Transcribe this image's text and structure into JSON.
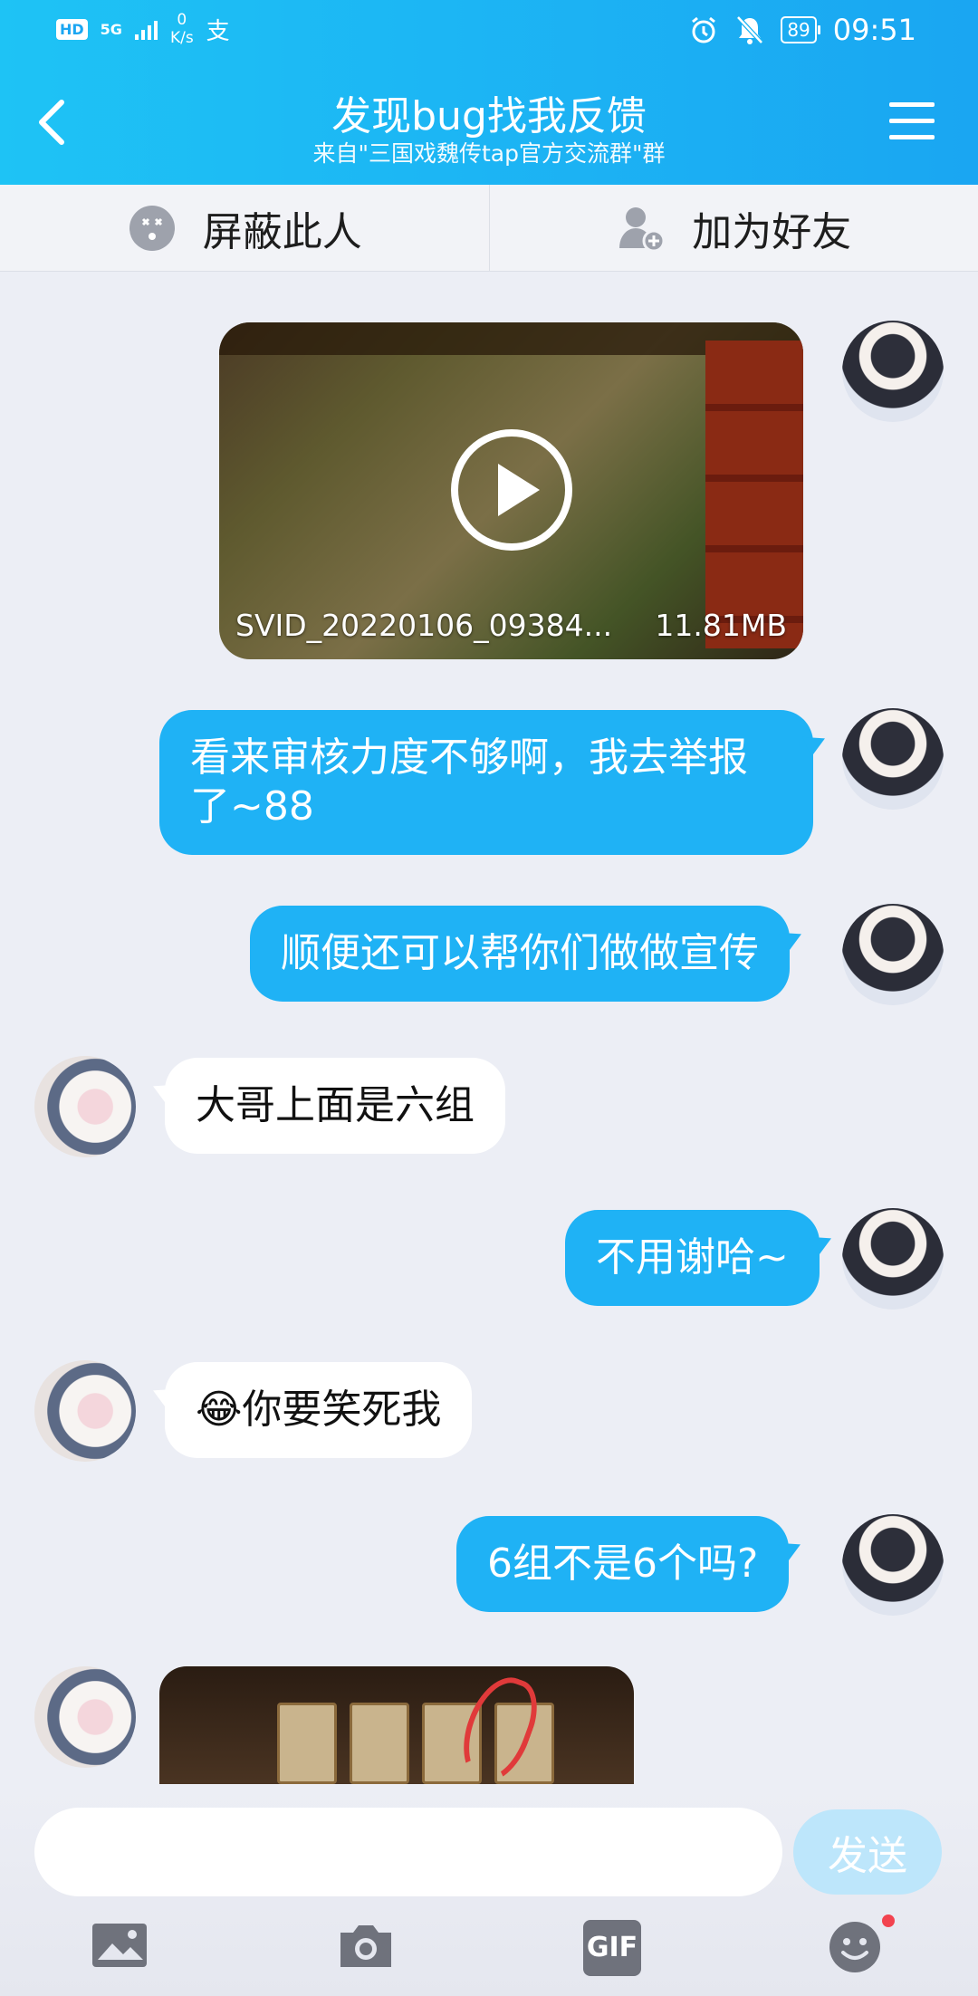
{
  "status_bar": {
    "network_badge": "HD",
    "network_type": "5G",
    "speed_value": "0",
    "speed_unit": "K/s",
    "battery": "89",
    "time": "09:51"
  },
  "header": {
    "title": "发现bug找我反馈",
    "subtitle": "来自\"三国戏魏传tap官方交流群\"群"
  },
  "actions": {
    "block_label": "屏蔽此人",
    "add_friend_label": "加为好友"
  },
  "messages": {
    "video": {
      "filename": "SVID_20220106_09384...",
      "size": "11.81MB"
    },
    "m1": "看来审核力度不够啊，我去举报了~88",
    "m2": "顺便还可以帮你们做做宣传",
    "m3": "大哥上面是六组",
    "m4": "不用谢哈~",
    "m5": "😂你要笑死我",
    "m6": "6组不是6个吗?"
  },
  "input": {
    "placeholder": "",
    "send_label": "发送"
  },
  "toolbar": {
    "gif_label": "GIF"
  },
  "colors": {
    "header_start": "#1ec3f5",
    "header_end": "#1aa6f2",
    "my_bubble": "#1fb2f5",
    "background": "#eceef5",
    "send_disabled": "#bde6fb"
  },
  "icons": [
    "back-icon",
    "menu-icon",
    "block-icon",
    "add-friend-icon",
    "play-icon",
    "image-icon",
    "camera-icon",
    "gif-icon",
    "emoji-icon",
    "alarm-icon",
    "mute-icon"
  ]
}
